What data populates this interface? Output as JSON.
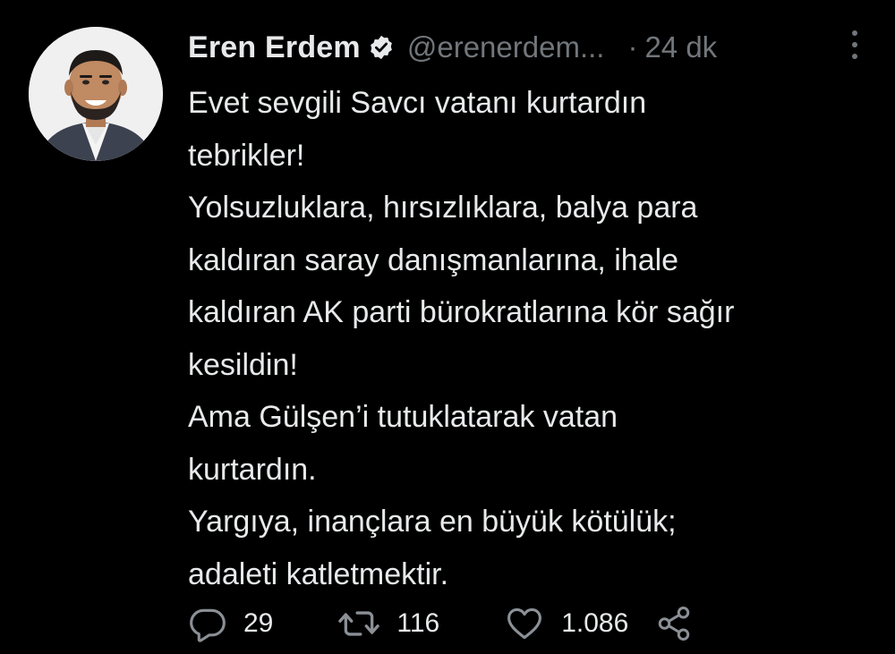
{
  "author": {
    "name": "Eren Erdem",
    "handle": "@erenerdem...",
    "dot": "·",
    "time": "24 dk"
  },
  "tweet": {
    "lines": [
      "Evet sevgili Savcı vatanı kurtardın",
      "tebrikler!",
      "Yolsuzluklara, hırsızlıklara, balya para",
      "kaldıran saray danışmanlarına, ihale",
      "kaldıran AK parti bürokratlarına kör sağır",
      "kesildin!",
      "Ama Gülşen’i tutuklatarak vatan",
      "kurtardın.",
      "Yargıya, inançlara en büyük kötülük;",
      "adaleti katletmektir."
    ]
  },
  "actions": {
    "replies": "29",
    "retweets": "116",
    "likes": "1.086"
  },
  "icons": {
    "verified": "verified-badge-icon",
    "more": "more-vertical-icon",
    "reply": "reply-icon",
    "retweet": "retweet-icon",
    "like": "heart-icon",
    "share": "share-icon"
  },
  "colors": {
    "background": "#000000",
    "text": "#e7e9ea",
    "muted": "#71767b"
  }
}
